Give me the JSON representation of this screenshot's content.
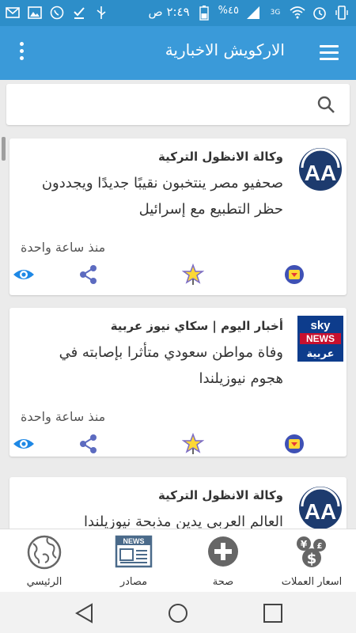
{
  "status_bar": {
    "time": "٢:٤٩ ص",
    "battery": "%٤٥"
  },
  "app_bar": {
    "title": "الاركويش الاخبارية"
  },
  "search": {
    "placeholder": ""
  },
  "cards": [
    {
      "source": "وكالة الانظول التركية",
      "headline": "صحفيو مصر ينتخبون نقيبًا جديدًا ويجددون حظر التطبيع مع إسرائيل",
      "time": "منذ ساعة واحدة",
      "logo": "aa-logo"
    },
    {
      "source": "أخبار اليوم | سكاي نيوز عربية",
      "headline": "وفاة مواطن سعودي متأثرا بإصابته في هجوم نيوزيلندا",
      "time": "منذ ساعة واحدة",
      "logo": "sky-news-arabia-logo",
      "logo_text": {
        "line1": "sky",
        "line2": "NEWS",
        "line3": "عربية"
      }
    },
    {
      "source": "وكالة الانظول التركية",
      "headline": "العالم العربي يدين مذبحة نيوزيلندا",
      "time": "",
      "logo": "aa-logo"
    }
  ],
  "bottom_nav": {
    "items": [
      {
        "label": "اسعار العملات",
        "icon": "currency-icon"
      },
      {
        "label": "صحة",
        "icon": "health-plus-icon"
      },
      {
        "label": "مصادر",
        "icon": "news-icon"
      },
      {
        "label": "الرئيسي",
        "icon": "globe-icon"
      }
    ]
  },
  "colors": {
    "status_bar": "#2d8ec9",
    "app_bar": "#3a9ad9",
    "eye": "#1e88e5",
    "share": "#5c6bc0"
  },
  "aa_logo_text": "AA",
  "news_icon_text": "NEWS"
}
